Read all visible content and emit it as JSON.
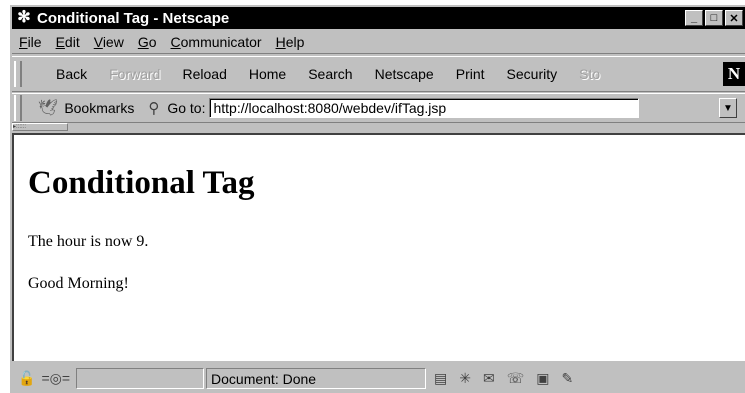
{
  "window": {
    "title": "Conditional Tag - Netscape",
    "controls": {
      "minimize": "_",
      "maximize": "□",
      "close": "✕"
    }
  },
  "menu": [
    {
      "key": "F",
      "rest": "ile"
    },
    {
      "key": "E",
      "rest": "dit"
    },
    {
      "key": "V",
      "rest": "iew"
    },
    {
      "key": "G",
      "rest": "o"
    },
    {
      "key": "C",
      "rest": "ommunicator"
    },
    {
      "key": "H",
      "rest": "elp"
    }
  ],
  "toolbar": {
    "back": "Back",
    "forward": "Forward",
    "reload": "Reload",
    "home": "Home",
    "search": "Search",
    "netscape": "Netscape",
    "print": "Print",
    "security": "Security",
    "stop": "Sto",
    "logo": "N"
  },
  "location": {
    "bookmarks_label": "Bookmarks",
    "goto_label": "Go to:",
    "url": "http://localhost:8080/webdev/ifTag.jsp"
  },
  "page": {
    "heading": "Conditional Tag",
    "hour_line": "The hour is now 9.",
    "greeting": "Good Morning!"
  },
  "status": {
    "text": "Document: Done"
  },
  "icons": {
    "app": "netscape-snowflake-icon",
    "bookmarks": "bookmarks-icon",
    "goto": "goto-icon",
    "security_lock": "lock-icon",
    "connection": "connection-icon"
  }
}
